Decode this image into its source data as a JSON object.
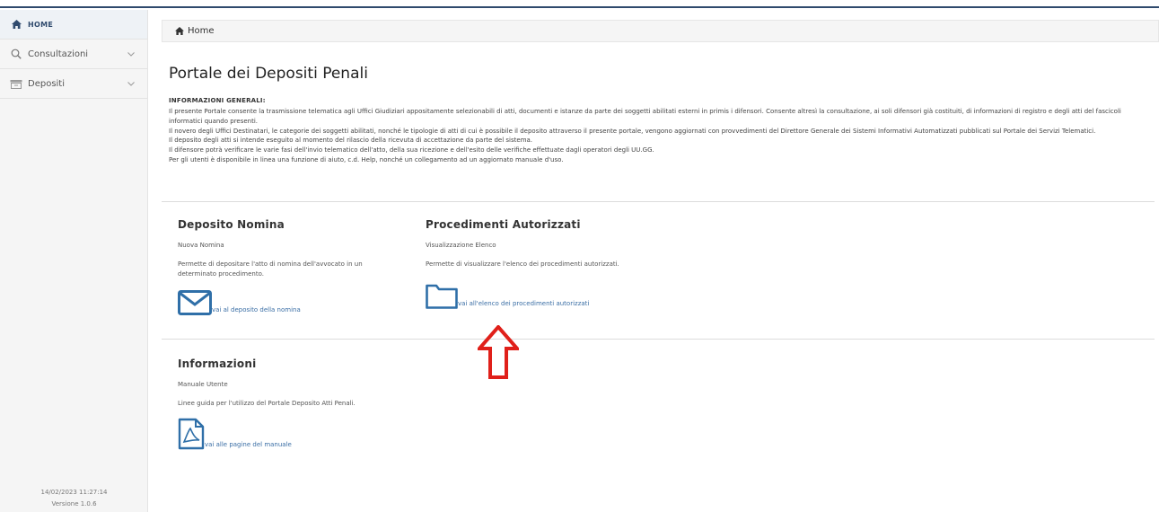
{
  "sidebar": {
    "items": [
      {
        "label": "HOME",
        "icon": "home-icon",
        "active": true
      },
      {
        "label": "Consultazioni",
        "icon": "search-icon",
        "active": false
      },
      {
        "label": "Depositi",
        "icon": "archive-icon",
        "active": false
      }
    ],
    "footer_timestamp": "14/02/2023 11:27:14",
    "footer_version": "Versione 1.0.6"
  },
  "breadcrumb": {
    "label": "Home"
  },
  "main": {
    "title": "Portale dei Depositi Penali",
    "info_heading": "INFORMAZIONI GENERALI:",
    "intro_paragraphs": [
      "Il presente Portale consente la trasmissione telematica agli Uffici Giudiziari appositamente selezionabili di atti, documenti e istanze da parte dei soggetti abilitati esterni in primis i difensori. Consente altresì la consultazione, ai soli difensori già costituiti, di informazioni di registro e degli atti del fascicoli informatici quando presenti.",
      "Il novero degli Uffici Destinatari, le categorie dei soggetti abilitati, nonché le tipologie di atti di cui è possibile il deposito attraverso il presente portale, vengono aggiornati con provvedimenti del Direttore Generale dei Sistemi Informativi Automatizzati pubblicati sul Portale dei Servizi Telematici.",
      "Il deposito degli atti si intende eseguito al momento del rilascio della ricevuta di accettazione da parte del sistema.",
      "Il difensore potrà verificare le varie fasi dell'invio telematico dell'atto, della sua ricezione e dell'esito delle verifiche effettuate dagli operatori degli UU.GG.",
      "Per gli utenti è disponibile in linea una funzione di aiuto, c.d. Help, nonché un collegamento ad un aggiornato manuale d'uso."
    ]
  },
  "cards": {
    "deposito": {
      "title": "Deposito Nomina",
      "subtitle": "Nuova Nomina",
      "description": "Permette di depositare l'atto di nomina dell'avvocato in un determinato procedimento.",
      "link": "vai al deposito della nomina",
      "icon": "envelope-icon"
    },
    "procedimenti": {
      "title": "Procedimenti Autorizzati",
      "subtitle": "Visualizzazione Elenco",
      "description": "Permette di visualizzare l'elenco dei procedimenti autorizzati.",
      "link": "vai all'elenco dei procedimenti autorizzati",
      "icon": "folder-icon"
    },
    "informazioni": {
      "title": "Informazioni",
      "subtitle": "Manuale Utente",
      "description": "Linee guida per l'utilizzo del Portale Deposito Atti Penali.",
      "link": "vai alle pagine del manuale",
      "icon": "pdf-icon"
    }
  },
  "annotation": {
    "icon": "red-arrow-up-icon",
    "color": "#e0201a"
  },
  "colors": {
    "accent": "#2f6fa8",
    "link": "#3a6ea5",
    "nav_dark": "#2f4a6d"
  }
}
